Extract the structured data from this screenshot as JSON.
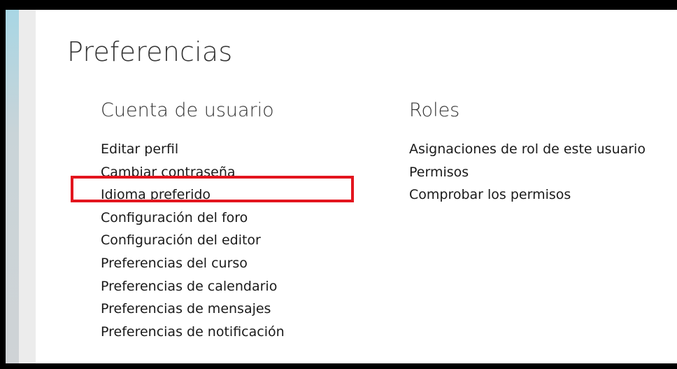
{
  "page": {
    "title": "Preferencias"
  },
  "user_account": {
    "heading": "Cuenta de usuario",
    "links": [
      "Editar perfil",
      "Cambiar contraseña",
      "Idioma preferido",
      "Configuración del foro",
      "Configuración del editor",
      "Preferencias del curso",
      "Preferencias de calendario",
      "Preferencias de mensajes",
      "Preferencias de notificación"
    ]
  },
  "roles": {
    "heading": "Roles",
    "links": [
      "Asignaciones de rol de este usuario",
      "Permisos",
      "Comprobar los permisos"
    ]
  },
  "colors": {
    "highlight_border": "#e3151e",
    "text": "#1a1a1a",
    "heading": "#333333"
  }
}
